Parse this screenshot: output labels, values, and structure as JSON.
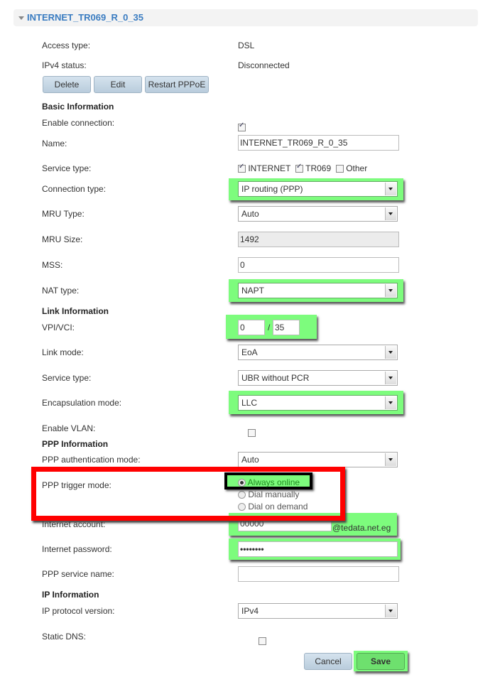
{
  "header": {
    "title": "INTERNET_TR069_R_0_35"
  },
  "status": {
    "access_type_label": "Access type:",
    "access_type": "DSL",
    "ipv4_label": "IPv4 status:",
    "ipv4": "Disconnected"
  },
  "actions": {
    "delete": "Delete",
    "edit": "Edit",
    "restart": "Restart PPPoE"
  },
  "basic": {
    "title": "Basic Information",
    "enable_label": "Enable connection:",
    "enable": true,
    "name_label": "Name:",
    "name": "INTERNET_TR069_R_0_35",
    "service_label": "Service type:",
    "service_opts": [
      {
        "label": "INTERNET",
        "checked": true
      },
      {
        "label": "TR069",
        "checked": true
      },
      {
        "label": "Other",
        "checked": false
      }
    ],
    "conn_label": "Connection type:",
    "conn": "IP routing (PPP)",
    "mru_type_label": "MRU Type:",
    "mru_type": "Auto",
    "mru_size_label": "MRU Size:",
    "mru_size": "1492",
    "mss_label": "MSS:",
    "mss": "0",
    "nat_label": "NAT type:",
    "nat": "NAPT"
  },
  "link": {
    "title": "Link Information",
    "vpivci_label": "VPI/VCI:",
    "vpi": "0",
    "sep": "/",
    "vci": "35",
    "mode_label": "Link mode:",
    "mode": "EoA",
    "service_label": "Service type:",
    "service": "UBR without PCR",
    "encap_label": "Encapsulation mode:",
    "encap": "LLC",
    "vlan_label": "Enable VLAN:",
    "vlan": false
  },
  "ppp": {
    "title": "PPP Information",
    "auth_label": "PPP authentication mode:",
    "auth": "Auto",
    "trigger_label": "PPP trigger mode:",
    "trigger_opts": [
      "Always online",
      "Dial manually",
      "Dial on demand"
    ],
    "trigger_selected": "Always online",
    "account_label": "Internet account:",
    "account": "00000",
    "account_suffix": "@tedata.net.eg",
    "password_label": "Internet password:",
    "password": "••••••••",
    "svc_label": "PPP service name:",
    "svc": ""
  },
  "ip": {
    "title": "IP Information",
    "proto_label": "IP protocol version:",
    "proto": "IPv4",
    "dns_label": "Static DNS:",
    "dns": false
  },
  "footer": {
    "cancel": "Cancel",
    "save": "Save"
  },
  "colors": {
    "highlight": "#7dfc7d",
    "annotation_red": "#ff0000",
    "annotation_black": "#000000",
    "title_blue": "#3a7cc1"
  }
}
